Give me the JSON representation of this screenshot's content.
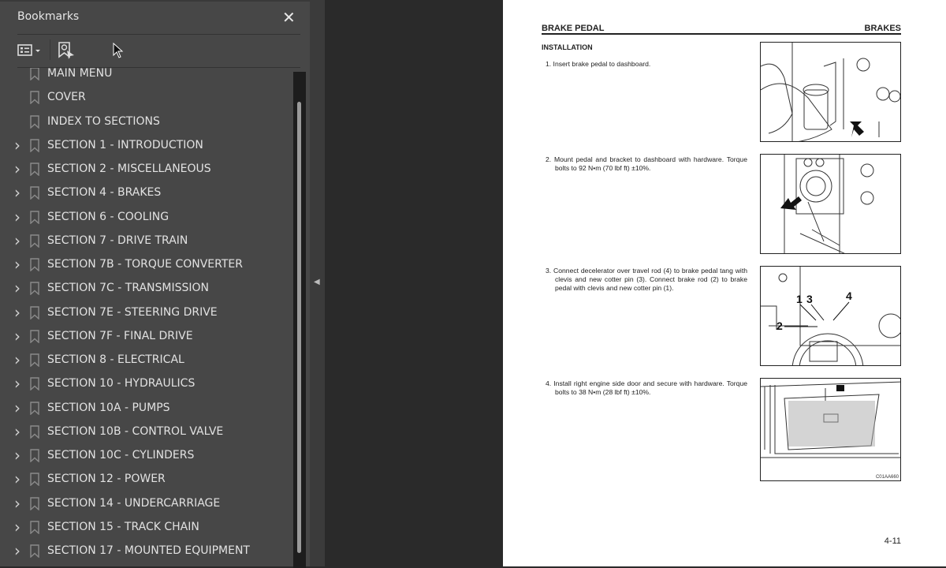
{
  "sidebar": {
    "title": "Bookmarks",
    "close_icon": "close-icon",
    "items": [
      {
        "label": "MAIN MENU",
        "expandable": false
      },
      {
        "label": "COVER",
        "expandable": false
      },
      {
        "label": "INDEX TO SECTIONS",
        "expandable": false
      },
      {
        "label": "SECTION 1 - INTRODUCTION",
        "expandable": true
      },
      {
        "label": "SECTION 2 - MISCELLANEOUS",
        "expandable": true
      },
      {
        "label": "SECTION 4 - BRAKES",
        "expandable": true
      },
      {
        "label": "SECTION 6 - COOLING",
        "expandable": true
      },
      {
        "label": "SECTION 7 - DRIVE TRAIN",
        "expandable": true
      },
      {
        "label": "SECTION 7B - TORQUE CONVERTER",
        "expandable": true
      },
      {
        "label": "SECTION 7C - TRANSMISSION",
        "expandable": true
      },
      {
        "label": "SECTION 7E - STEERING DRIVE",
        "expandable": true
      },
      {
        "label": "SECTION 7F - FINAL DRIVE",
        "expandable": true
      },
      {
        "label": "SECTION 8 - ELECTRICAL",
        "expandable": true
      },
      {
        "label": "SECTION 10 - HYDRAULICS",
        "expandable": true
      },
      {
        "label": "SECTION 10A - PUMPS",
        "expandable": true
      },
      {
        "label": "SECTION 10B - CONTROL VALVE",
        "expandable": true
      },
      {
        "label": "SECTION 10C - CYLINDERS",
        "expandable": true
      },
      {
        "label": "SECTION 12 - POWER",
        "expandable": true
      },
      {
        "label": "SECTION 14 - UNDERCARRIAGE",
        "expandable": true
      },
      {
        "label": "SECTION 15 - TRACK CHAIN",
        "expandable": true
      },
      {
        "label": "SECTION 17 - MOUNTED EQUIPMENT",
        "expandable": true
      }
    ]
  },
  "document": {
    "header_left": "BRAKE PEDAL",
    "header_right": "BRAKES",
    "subheading": "INSTALLATION",
    "steps": [
      "1.  Insert brake pedal to dashboard.",
      "2.  Mount pedal and bracket to dashboard with hardware. Torque bolts to  92 N•m (70 lbf ft) ±10%.",
      "3.  Connect decelerator over travel rod (4) to brake pedal tang with clevis and new cotter pin (3). Connect brake rod (2) to brake pedal with clevis and new cotter pin (1).",
      "4.  Install right engine side door and secure with hardware. Torque bolts to 38 N•m (28 lbf ft) ±10%."
    ],
    "figure_callouts": [
      "1",
      "3",
      "4",
      "2"
    ],
    "figure4_caption": "C01AA660",
    "page_number": "4-11"
  }
}
